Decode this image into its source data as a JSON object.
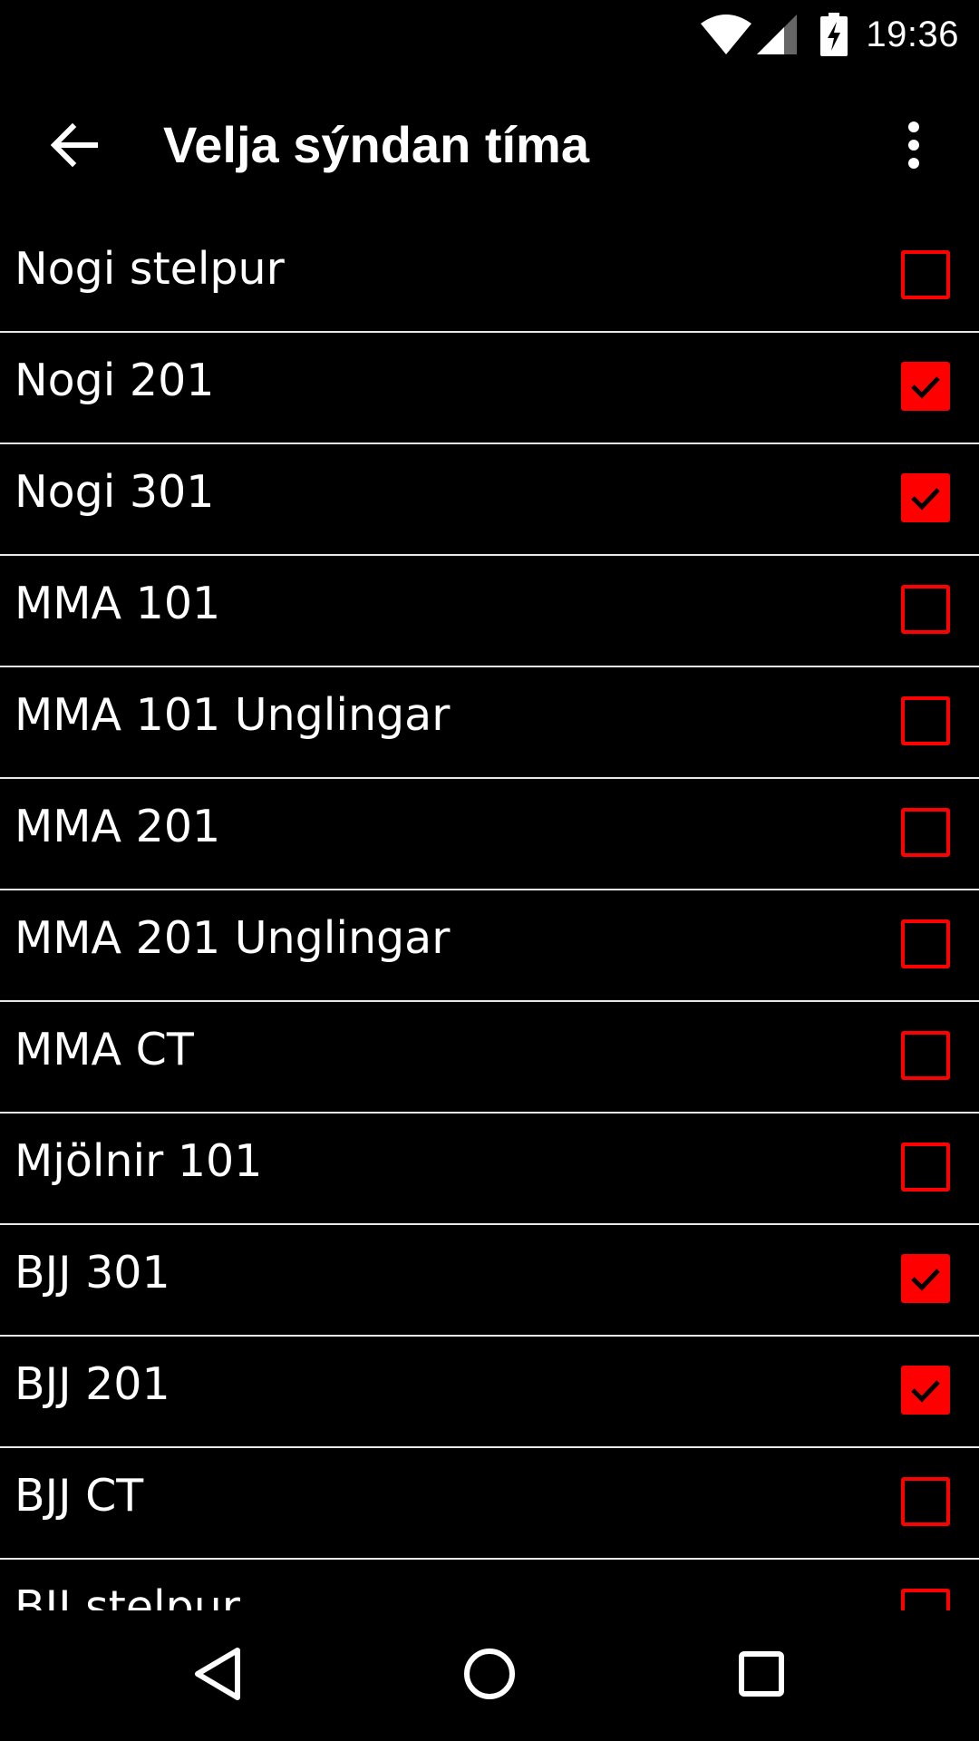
{
  "status_bar": {
    "time": "19:36",
    "icons": [
      "wifi-icon",
      "cell-signal-icon",
      "battery-charging-icon"
    ]
  },
  "app_bar": {
    "title": "Velja sýndan tíma",
    "back_icon": "arrow-back-icon",
    "menu_icon": "more-vert-icon"
  },
  "list": {
    "items": [
      {
        "label": "Nogi stelpur",
        "checked": false
      },
      {
        "label": "Nogi 201",
        "checked": true
      },
      {
        "label": "Nogi 301",
        "checked": true
      },
      {
        "label": "MMA 101",
        "checked": false
      },
      {
        "label": "MMA 101 Unglingar",
        "checked": false
      },
      {
        "label": "MMA 201",
        "checked": false
      },
      {
        "label": "MMA 201 Unglingar",
        "checked": false
      },
      {
        "label": "MMA CT",
        "checked": false
      },
      {
        "label": "Mjölnir 101",
        "checked": false
      },
      {
        "label": "BJJ 301",
        "checked": true
      },
      {
        "label": "BJJ 201",
        "checked": true
      },
      {
        "label": "BJJ CT",
        "checked": false
      },
      {
        "label": "BJJ stelpur",
        "checked": false
      }
    ]
  },
  "nav_bar": {
    "icons": [
      "back-triangle-icon",
      "home-circle-icon",
      "recents-square-icon"
    ]
  },
  "colors": {
    "background": "#000000",
    "accent": "#ff0000",
    "divider": "#e8e8e8",
    "text": "#ffffff"
  }
}
